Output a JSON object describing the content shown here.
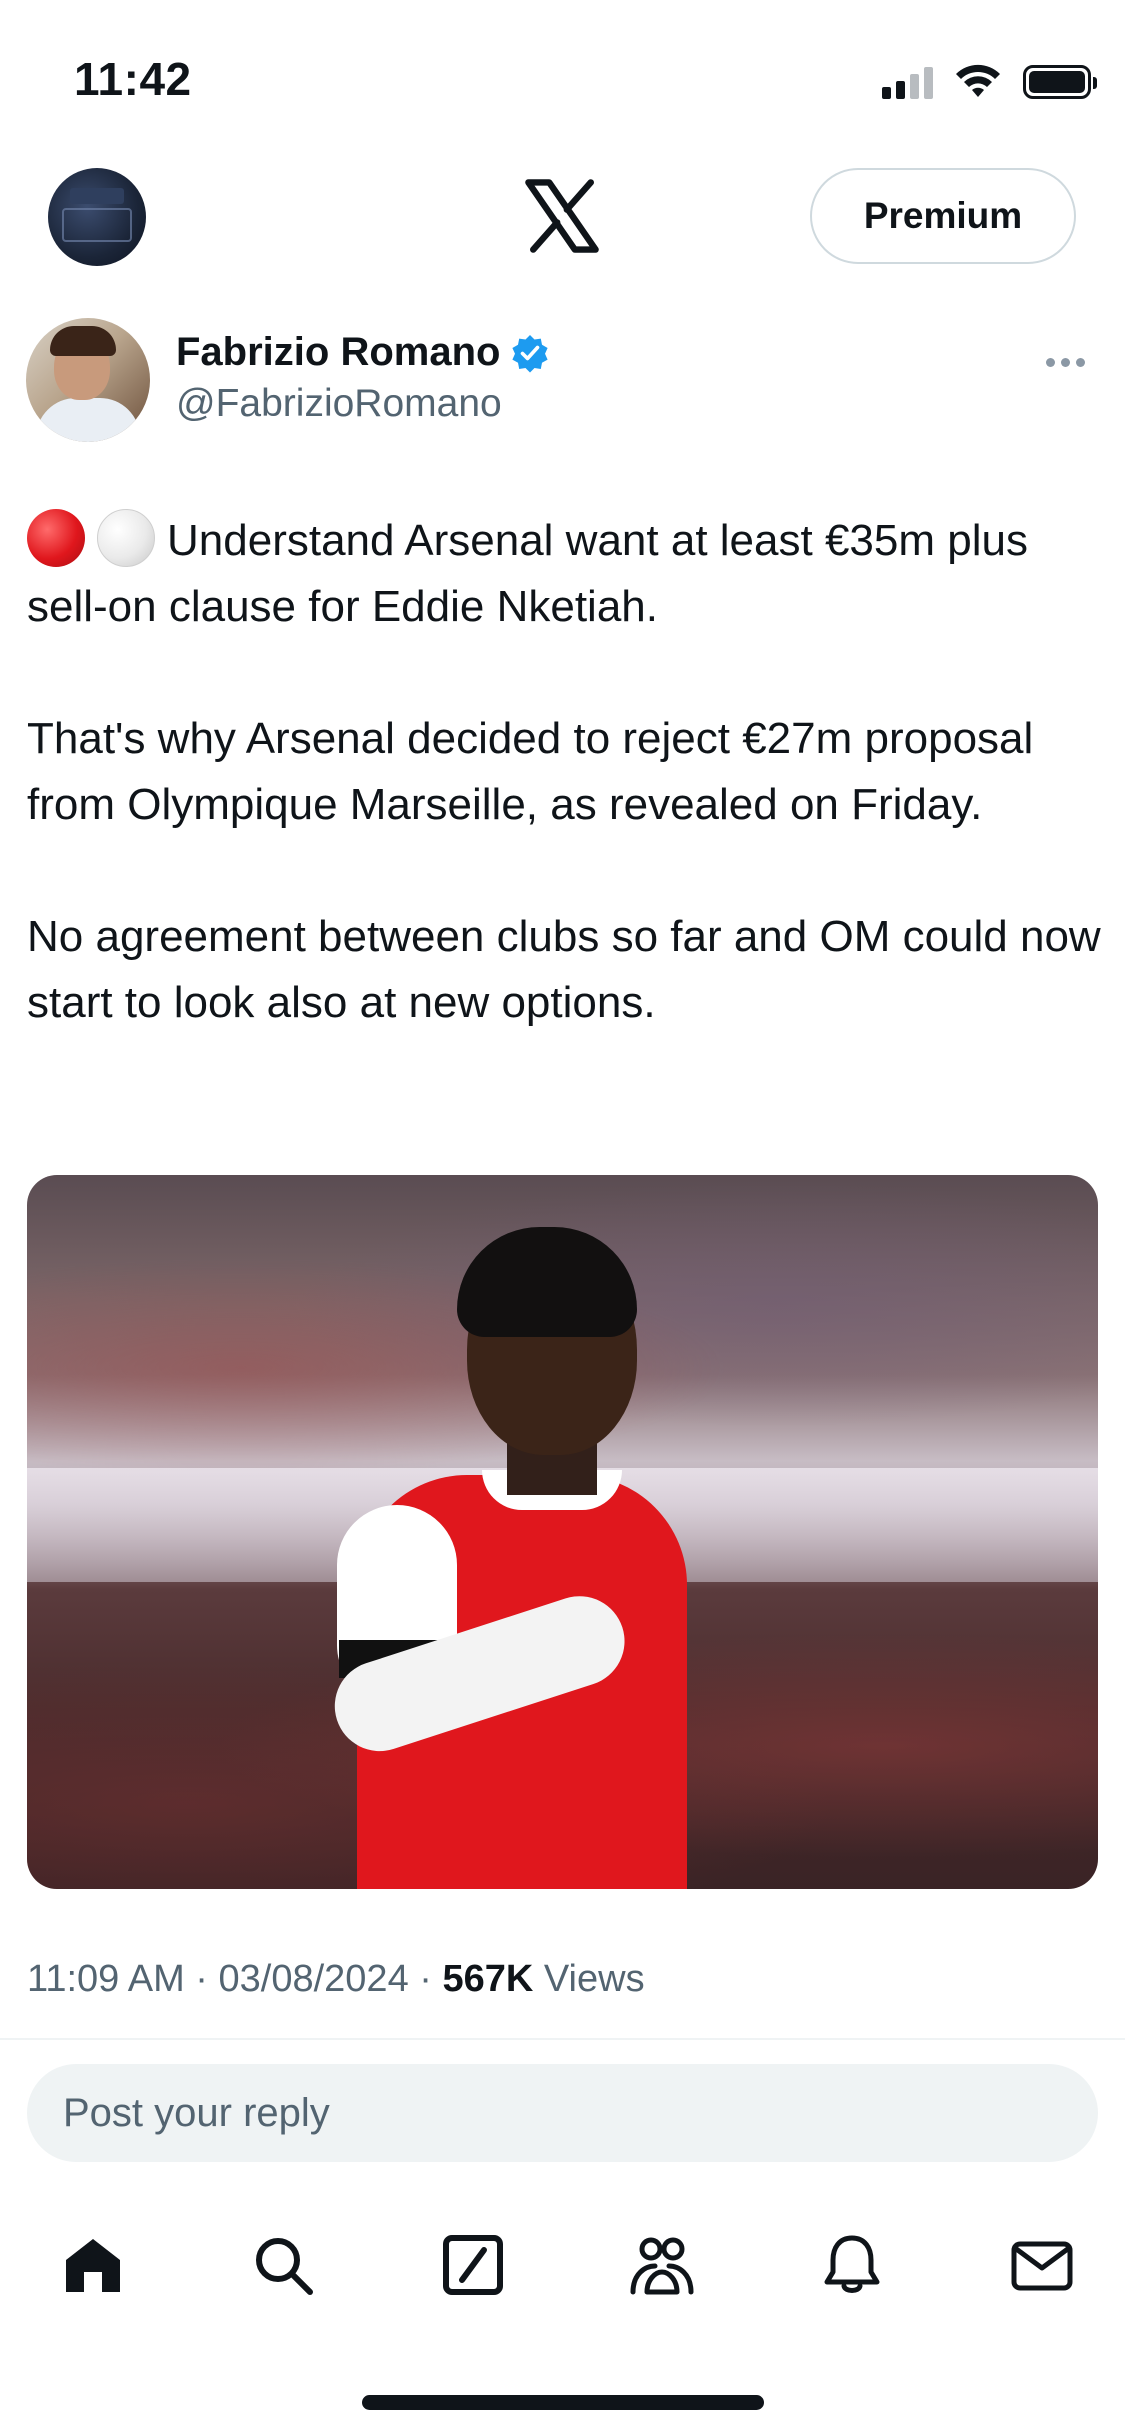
{
  "status_bar": {
    "time": "11:42",
    "icons": [
      "cellular-signal-icon",
      "wifi-icon",
      "battery-icon"
    ]
  },
  "header": {
    "logo": "x-logo-icon",
    "premium_label": "Premium"
  },
  "tweet": {
    "author_name": "Fabrizio Romano",
    "author_handle": "@FabrizioRomano",
    "verified": true,
    "paragraphs": [
      "Understand Arsenal want at least €35m plus sell-on clause for Eddie Nketiah.",
      "That's why Arsenal decided to reject €27m proposal from Olympique Marseille, as revealed on Friday.",
      "No agreement between clubs so far and OM could now start to look also at new options."
    ],
    "leading_emojis": [
      "red-circle",
      "white-circle"
    ],
    "time": "11:09 AM",
    "date": "03/08/2024",
    "views_count": "567K",
    "views_label": "Views",
    "separator": "·"
  },
  "reply": {
    "placeholder": "Post your reply"
  },
  "tab_bar": {
    "items": [
      "home-icon",
      "search-icon",
      "grok-icon",
      "communities-icon",
      "notifications-icon",
      "messages-icon"
    ]
  },
  "colors": {
    "text_primary": "#0f1419",
    "text_secondary": "#536471",
    "verified_blue": "#1d9bf0",
    "reply_bg": "#eff3f4"
  }
}
